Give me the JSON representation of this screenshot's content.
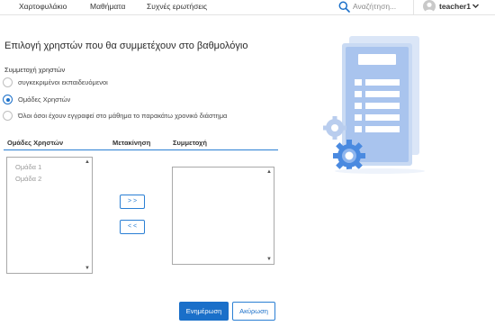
{
  "nav": {
    "links": [
      "Χαρτοφυλάκιο",
      "Μαθήματα",
      "Συχνές ερωτήσεις"
    ],
    "search_placeholder": "Αναζήτηση...",
    "user_name": "teacher1"
  },
  "page": {
    "title": "Επιλογή χρηστών που θα συμμετέχουν στο βαθμολόγιο"
  },
  "participation": {
    "label": "Συμμετοχή χρηστών",
    "options": [
      {
        "label": "συγκεκριμένοι εκπαιδευόμενοι",
        "selected": false
      },
      {
        "label": "Ομάδες Χρηστών",
        "selected": true
      },
      {
        "label": "Όλοι όσοι έχουν εγγραφεί στο μάθημα το παρακάτω χρονικό διάστημα",
        "selected": false
      }
    ]
  },
  "columns": {
    "groups": "Ομάδες Χρηστών",
    "move": "Μετακίνηση",
    "participation": "Συμμετοχή"
  },
  "groups_list": [
    "Ομάδα 1",
    "Ομάδα 2"
  ],
  "move_buttons": {
    "add": "> >",
    "remove": "< <"
  },
  "actions": {
    "update": "Ενημέρωση",
    "cancel": "Ακύρωση"
  },
  "colors": {
    "accent": "#1a6fc9",
    "illustration_light": "#dbe6f7",
    "illustration_blue": "#4a8ae0"
  }
}
